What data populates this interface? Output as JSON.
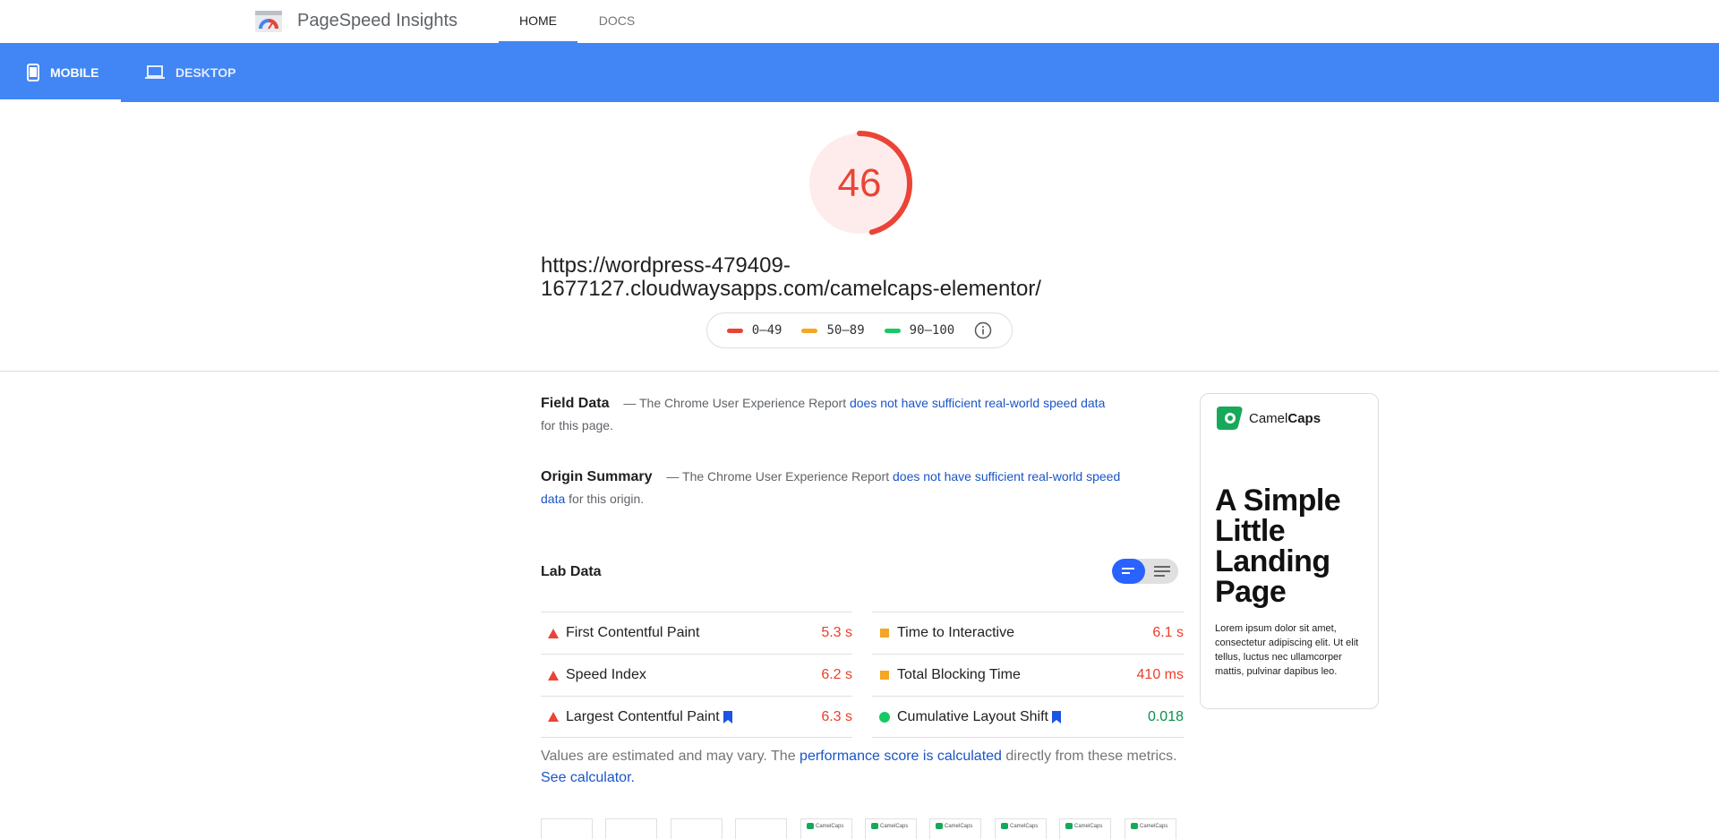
{
  "header": {
    "app_name": "PageSpeed Insights",
    "tabs": [
      {
        "label": "HOME",
        "active": true
      },
      {
        "label": "DOCS",
        "active": false
      }
    ]
  },
  "device_tabs": [
    {
      "label": "MOBILE",
      "icon": "phone-icon",
      "active": true
    },
    {
      "label": "DESKTOP",
      "icon": "laptop-icon",
      "active": false
    }
  ],
  "score": {
    "value": "46",
    "fraction": 0.46,
    "color": "#eb4335"
  },
  "url_line1": "https://wordpress-479409-",
  "url_line2": "1677127.cloudwaysapps.com/camelcaps-elementor/",
  "legend": [
    {
      "label": "0–49",
      "color": "#eb4335"
    },
    {
      "label": "50–89",
      "color": "#f5a622"
    },
    {
      "label": "90–100",
      "color": "#18c964"
    }
  ],
  "field_data": {
    "heading": "Field Data",
    "prefix": "— The Chrome User Experience Report",
    "link": "does not have sufficient real-world speed data",
    "suffix": "for this page."
  },
  "origin_summary": {
    "heading": "Origin Summary",
    "prefix": "— The Chrome User Experience Report",
    "link": "does not have sufficient real-world speed data",
    "suffix": "for this origin."
  },
  "lab_data": {
    "heading": "Lab Data",
    "left": [
      {
        "name": "First Contentful Paint",
        "value": "5.3 s",
        "status": "fail",
        "bookmark": false
      },
      {
        "name": "Speed Index",
        "value": "6.2 s",
        "status": "fail",
        "bookmark": false
      },
      {
        "name": "Largest Contentful Paint",
        "value": "6.3 s",
        "status": "fail",
        "bookmark": true
      }
    ],
    "right": [
      {
        "name": "Time to Interactive",
        "value": "6.1 s",
        "status": "average",
        "bookmark": false
      },
      {
        "name": "Total Blocking Time",
        "value": "410 ms",
        "status": "average",
        "bookmark": false
      },
      {
        "name": "Cumulative Layout Shift",
        "value": "0.018",
        "status": "pass",
        "bookmark": true
      }
    ]
  },
  "note": {
    "text1": "Values are estimated and may vary. The",
    "link1": "performance score is calculated",
    "text2": "directly from these metrics.",
    "link2": "See calculator."
  },
  "preview": {
    "brand_regular": "Camel",
    "brand_bold": "Caps",
    "title": "A Simple Little Landing Page",
    "body": "Lorem ipsum dolor sit amet, consectetur adipiscing elit. Ut elit tellus, luctus nec ullamcorper mattis, pulvinar dapibus leo."
  },
  "filmstrip": {
    "frames": 10,
    "blank_frames": 4,
    "mini_label": "CamelCaps"
  }
}
